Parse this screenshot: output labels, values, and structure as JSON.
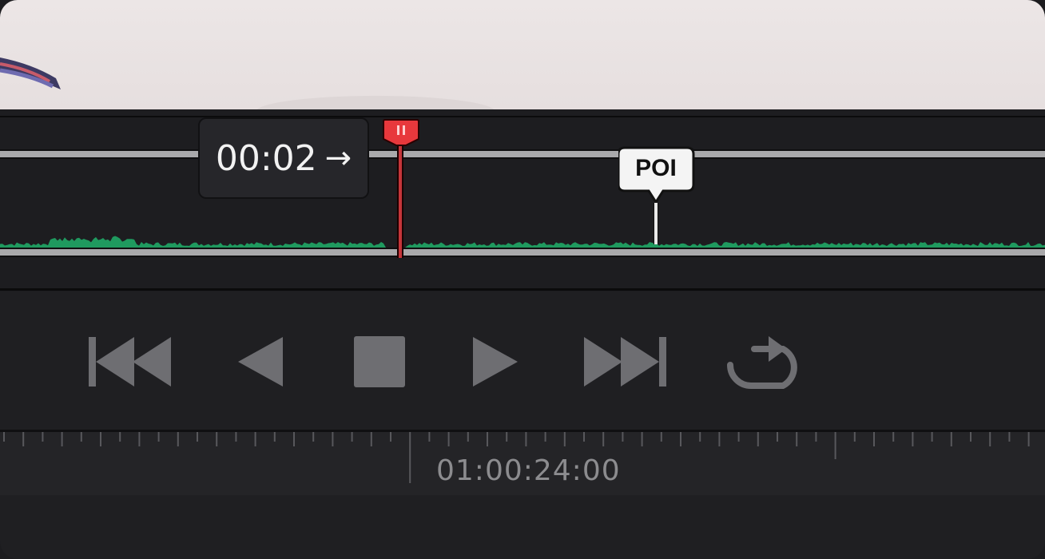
{
  "timeline": {
    "tooltip_time": "00:02",
    "tooltip_arrow": "→",
    "marker_label": "POI",
    "playhead_color": "#e53935",
    "waveform_color": "#1f9a5f"
  },
  "transport": {
    "buttons": [
      {
        "icon": "skip-to-start-icon"
      },
      {
        "icon": "play-reverse-icon"
      },
      {
        "icon": "stop-icon"
      },
      {
        "icon": "play-icon"
      },
      {
        "icon": "skip-to-end-icon"
      },
      {
        "icon": "loop-icon"
      }
    ],
    "icon_color": "#6e6e72"
  },
  "ruler": {
    "timecode": "01:00:24:00"
  }
}
